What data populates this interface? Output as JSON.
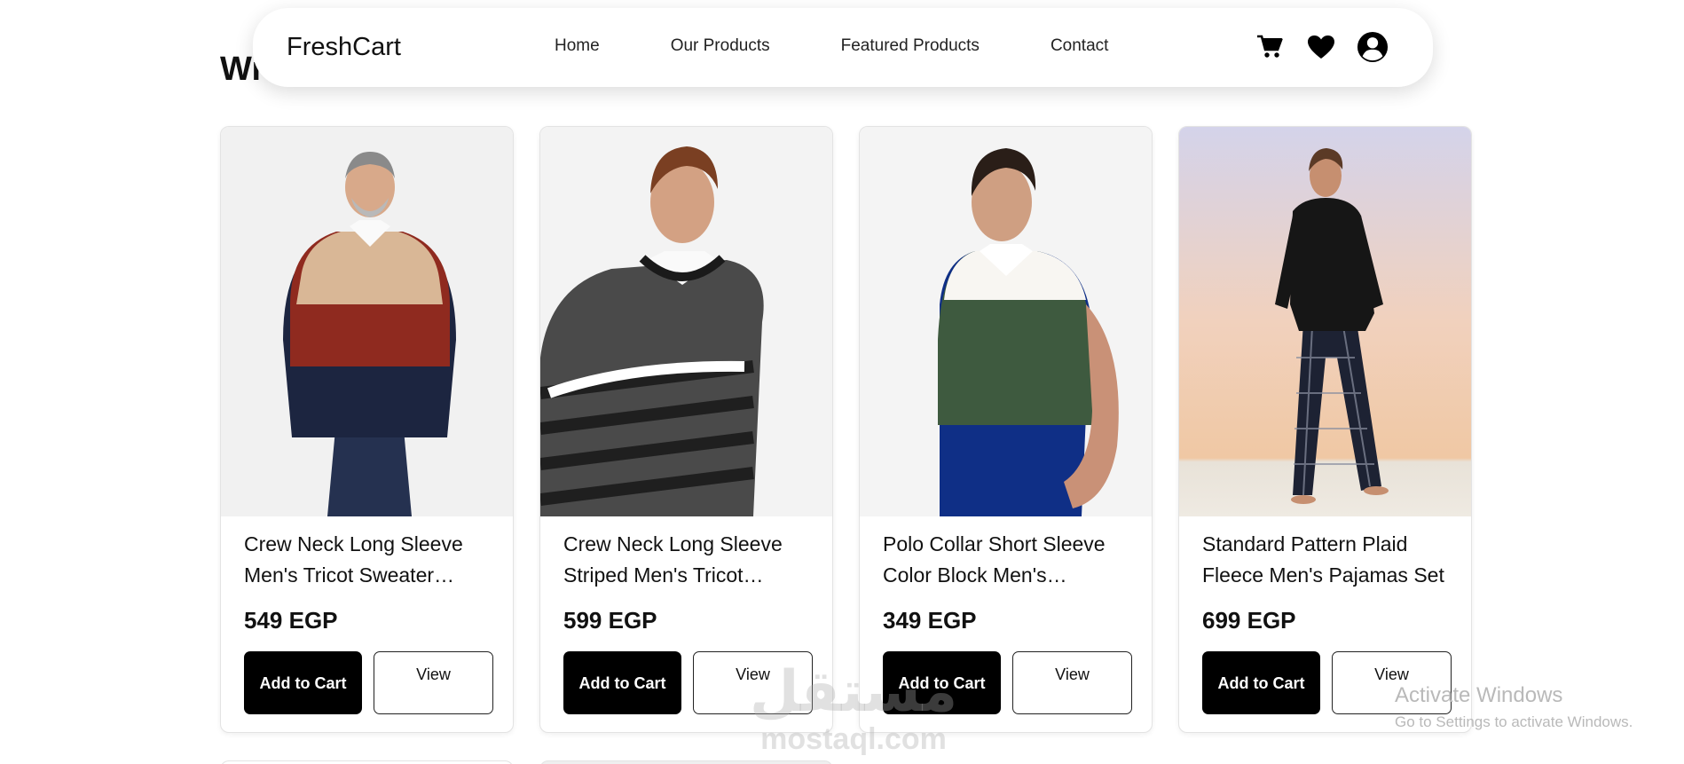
{
  "navbar": {
    "brand": "FreshCart",
    "links": [
      "Home",
      "Our Products",
      "Featured Products",
      "Contact"
    ],
    "icons": [
      "cart-icon",
      "heart-icon",
      "user-icon"
    ]
  },
  "heading": "Wi",
  "products": [
    {
      "title": "Crew Neck Long Sleeve Men's Tricot Sweater with...",
      "price": "549 EGP",
      "add_label": "Add to Cart",
      "view_label": "View"
    },
    {
      "title": "Crew Neck Long Sleeve Striped Men's Tricot Sweater",
      "price": "599 EGP",
      "add_label": "Add to Cart",
      "view_label": "View"
    },
    {
      "title": "Polo Collar Short Sleeve Color Block Men's Knitwea...",
      "price": "349 EGP",
      "add_label": "Add to Cart",
      "view_label": "View"
    },
    {
      "title": "Standard Pattern Plaid Fleece Men's Pajamas Set",
      "price": "699 EGP",
      "add_label": "Add to Cart",
      "view_label": "View"
    }
  ],
  "os_overlay": {
    "title": "Activate Windows",
    "subtitle": "Go to Settings to activate Windows."
  },
  "watermark": {
    "arabic": "مستقل",
    "latin": "mostaql.com"
  },
  "colors": {
    "button_primary": "#000000",
    "text": "#111111",
    "card_border": "#e3e3e3"
  }
}
